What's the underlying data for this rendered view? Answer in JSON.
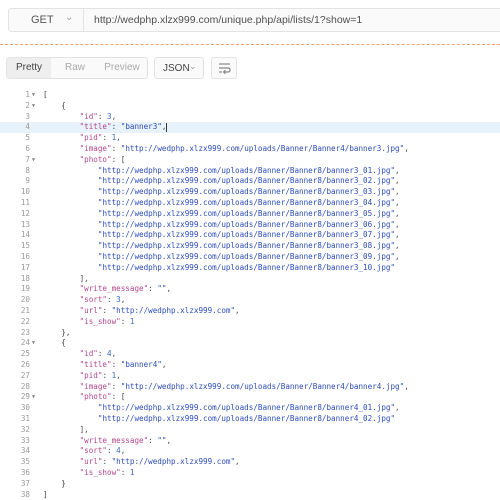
{
  "request": {
    "method": "GET",
    "url": "http://wedphp.xlzx999.com/unique.php/api/lists/1?show=1"
  },
  "toolbar": {
    "tabs": [
      "Pretty",
      "Raw",
      "Preview"
    ],
    "active_tab": "Pretty",
    "format": "JSON",
    "wrap_icon": "wrap-lines-icon"
  },
  "colors": {
    "key": "#b2478c",
    "string": "#2d4db8",
    "number": "#3b6dbf",
    "divider": "#f0a070",
    "highlight": "#e8f2fb"
  },
  "editor": {
    "cursor_line": 4,
    "lines": [
      "[",
      "    {",
      "        \"id\": 3,",
      "        \"title\": \"banner3\",",
      "        \"pid\": 1,",
      "        \"image\": \"http://wedphp.xlzx999.com/uploads/Banner/Banner4/banner3.jpg\",",
      "        \"photo\": [",
      "            \"http://wedphp.xlzx999.com/uploads/Banner/Banner8/banner3_01.jpg\",",
      "            \"http://wedphp.xlzx999.com/uploads/Banner/Banner8/banner3_02.jpg\",",
      "            \"http://wedphp.xlzx999.com/uploads/Banner/Banner8/banner3_03.jpg\",",
      "            \"http://wedphp.xlzx999.com/uploads/Banner/Banner8/banner3_04.jpg\",",
      "            \"http://wedphp.xlzx999.com/uploads/Banner/Banner8/banner3_05.jpg\",",
      "            \"http://wedphp.xlzx999.com/uploads/Banner/Banner8/banner3_06.jpg\",",
      "            \"http://wedphp.xlzx999.com/uploads/Banner/Banner8/banner3_07.jpg\",",
      "            \"http://wedphp.xlzx999.com/uploads/Banner/Banner8/banner3_08.jpg\",",
      "            \"http://wedphp.xlzx999.com/uploads/Banner/Banner8/banner3_09.jpg\",",
      "            \"http://wedphp.xlzx999.com/uploads/Banner/Banner8/banner3_10.jpg\"",
      "        ],",
      "        \"write_message\": \"\",",
      "        \"sort\": 3,",
      "        \"url\": \"http://wedphp.xlzx999.com\",",
      "        \"is_show\": 1",
      "    },",
      "    {",
      "        \"id\": 4,",
      "        \"title\": \"banner4\",",
      "        \"pid\": 1,",
      "        \"image\": \"http://wedphp.xlzx999.com/uploads/Banner/Banner4/banner4.jpg\",",
      "        \"photo\": [",
      "            \"http://wedphp.xlzx999.com/uploads/Banner/Banner8/banner4_01.jpg\",",
      "            \"http://wedphp.xlzx999.com/uploads/Banner/Banner8/banner4_02.jpg\"",
      "        ],",
      "        \"write_message\": \"\",",
      "        \"sort\": 4,",
      "        \"url\": \"http://wedphp.xlzx999.com\",",
      "        \"is_show\": 1",
      "    }",
      "]"
    ],
    "foldable_lines": [
      1,
      2,
      7,
      24,
      29
    ]
  }
}
